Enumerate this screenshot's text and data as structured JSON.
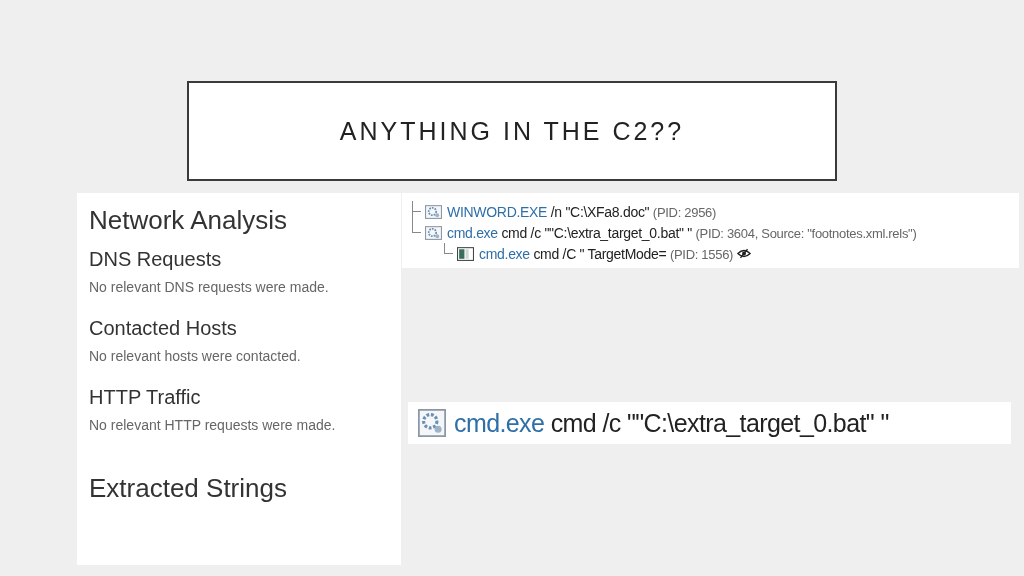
{
  "slide": {
    "title": "ANYTHING IN THE C2??"
  },
  "report": {
    "sections": [
      {
        "kind": "heading",
        "text": "Network Analysis"
      },
      {
        "kind": "subsection",
        "title": "DNS Requests",
        "text": "No relevant DNS requests were made."
      },
      {
        "kind": "subsection",
        "title": "Contacted Hosts",
        "text": "No relevant hosts were contacted."
      },
      {
        "kind": "subsection",
        "title": "HTTP Traffic",
        "text": "No relevant HTTP requests were made."
      },
      {
        "kind": "heading",
        "text": "Extracted Strings"
      }
    ]
  },
  "process_tree": [
    {
      "kind": "gear",
      "name": "WINWORD.EXE",
      "args": "/n \"C:\\XFa8.doc\"",
      "info": "(PID: 2956)",
      "hidden": false
    },
    {
      "kind": "gear",
      "name": "cmd.exe",
      "args": "cmd /c \"\"C:\\extra_target_0.bat\" \"",
      "info": "(PID: 3604, Source: \"footnotes.xml.rels\")",
      "hidden": false,
      "children": [
        {
          "kind": "console",
          "name": "cmd.exe",
          "args": "cmd /C \" TargetMode=",
          "info": "(PID: 1556)",
          "hidden": true
        }
      ]
    }
  ],
  "zoomed_process": {
    "kind": "gear",
    "name": "cmd.exe",
    "args": "cmd /c \"\"C:\\extra_target_0.bat\" \""
  }
}
